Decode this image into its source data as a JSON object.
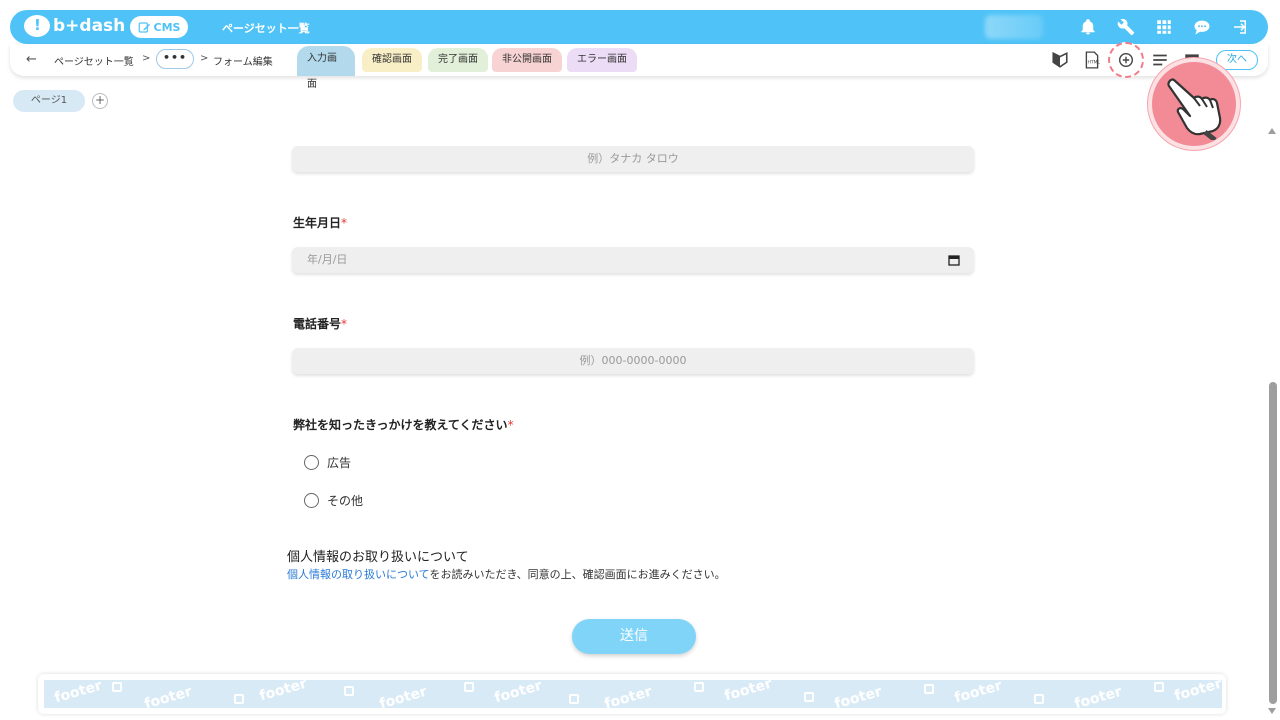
{
  "header": {
    "logo_text": "b+dash",
    "cms_label": "CMS",
    "title": "ページセット一覧",
    "icons": [
      "bell-icon",
      "wrench-icon",
      "grid-icon",
      "chat-icon",
      "logout-icon"
    ]
  },
  "subbar": {
    "back": "←",
    "crumb_root": "ページセット一覧",
    "sep": ">",
    "ellipsis": "•••",
    "crumb_current": "フォーム編集",
    "tabs": {
      "input": "入力画面",
      "confirm": "確認画面",
      "complete": "完了画面",
      "private": "非公開画面",
      "error": "エラー画面"
    },
    "next_label": "次へ",
    "tools": [
      "beginner-icon",
      "html-file-icon",
      "add-circle-icon",
      "list-icon",
      "window-icon"
    ]
  },
  "pages": {
    "page_label": "ページ1",
    "add_symbol": "+"
  },
  "form": {
    "name_placeholder": "例）タナカ タロウ",
    "birthday_label": "生年月日",
    "birthday_placeholder": "年/月/日",
    "phone_label": "電話番号",
    "phone_placeholder": "例）000-0000-0000",
    "source_label": "弊社を知ったきっかけを教えてください",
    "required_mark": "*",
    "options": [
      "広告",
      "その他"
    ],
    "privacy_title": "個人情報のお取り扱いについて",
    "privacy_link": "個人情報の取り扱いについて",
    "privacy_text": "をお読みいただき、同意の上、確認画面にお進みください。",
    "submit_label": "送信"
  },
  "footer": {
    "label": "footer"
  },
  "colors": {
    "brand": "#4fc3f7",
    "required": "#e53935",
    "link": "#2a7ad8",
    "highlight": "#f27b8a"
  }
}
